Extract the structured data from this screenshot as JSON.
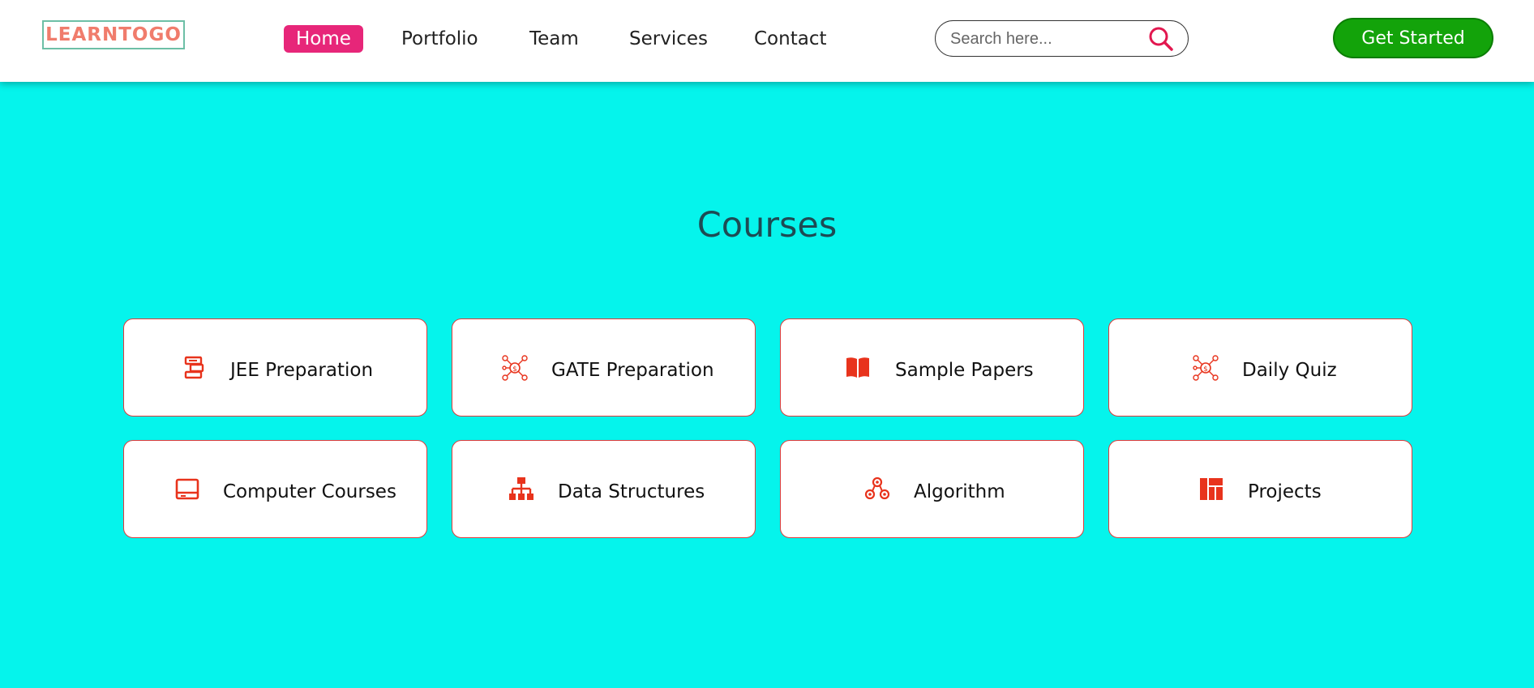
{
  "header": {
    "logo_text": "LEARNTOGO",
    "nav": [
      {
        "label": "Home",
        "active": true
      },
      {
        "label": "Portfolio",
        "active": false
      },
      {
        "label": "Team",
        "active": false
      },
      {
        "label": "Services",
        "active": false
      },
      {
        "label": "Contact",
        "active": false
      }
    ],
    "search": {
      "placeholder": "Search here...",
      "icon": "search-icon"
    },
    "cta_label": "Get Started"
  },
  "courses": {
    "title": "Courses",
    "items": [
      {
        "label": "JEE Preparation",
        "icon": "exam-icon"
      },
      {
        "label": "GATE Preparation",
        "icon": "network-icon"
      },
      {
        "label": "Sample Papers",
        "icon": "book-icon"
      },
      {
        "label": "Daily Quiz",
        "icon": "network-icon"
      },
      {
        "label": "Computer Courses",
        "icon": "laptop-icon"
      },
      {
        "label": "Data Structures",
        "icon": "sitemap-icon"
      },
      {
        "label": "Algorithm",
        "icon": "molecule-icon"
      },
      {
        "label": "Projects",
        "icon": "layout-icon"
      }
    ]
  },
  "colors": {
    "background": "#05f4ec",
    "accent_pink": "#e72679",
    "cta_green": "#13a30a",
    "icon_red": "#e8331c",
    "title": "#1d4b54"
  }
}
